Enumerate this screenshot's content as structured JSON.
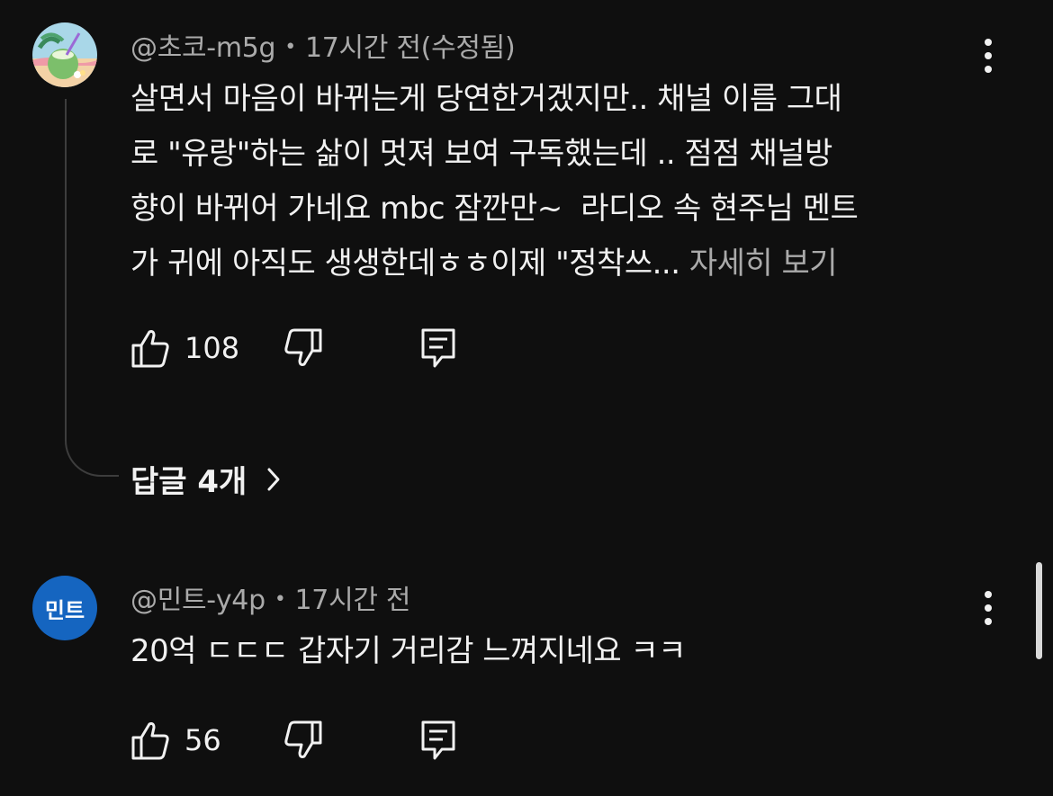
{
  "comments": [
    {
      "author": "@초코-m5g",
      "time": "17시간 전(수정됨)",
      "avatar_icon": "coconut-drink-avatar",
      "text": "살면서 마음이 바뀌는게 당연한거겠지만.. 채널 이름 그대\n로 \"유랑\"하는 삶이 멋져 보여 구독했는데 .. 점점 채널방\n향이 바뀌어 가네요 mbc 잠깐만~  라디오 속 현주님 멘트\n가 귀에 아직도 생생한데ㅎㅎ이제 \"정착쓰...",
      "more_label": " 자세히 보기",
      "likes": "108",
      "replies_label": "답글 4개"
    },
    {
      "author": "@민트-y4p",
      "time": "17시간 전",
      "avatar_text": "민트",
      "avatar_color": "#1565c0",
      "text": "20억 ㄷㄷㄷ 갑자기 거리감 느껴지네요 ㅋㅋ",
      "likes": "56"
    }
  ],
  "icons": {
    "like": "thumbs-up-icon",
    "dislike": "thumbs-down-icon",
    "reply": "reply-comment-icon",
    "menu": "more-vert-icon",
    "chevron": "chevron-right-icon"
  }
}
